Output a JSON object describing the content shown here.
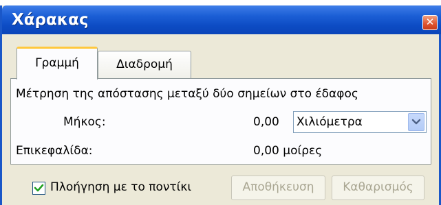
{
  "window": {
    "title": "Χάρακας",
    "close_icon": "close-icon"
  },
  "tabs": [
    {
      "label": "Γραμμή",
      "active": true
    },
    {
      "label": "Διαδρομή",
      "active": false
    }
  ],
  "panel": {
    "description": "Μέτρηση της απόστασης μεταξύ δύο σημείων στο έδαφος",
    "length_label": "Μήκος:",
    "length_value": "0,00",
    "unit_selected": "Χιλιόμετρα",
    "heading_label": "Επικεφαλίδα:",
    "heading_value": "0,00 μοίρες"
  },
  "footer": {
    "mouse_navigation_label": "Πλοήγηση με το ποντίκι",
    "mouse_navigation_checked": true,
    "save_label": "Αποθήκευση",
    "clear_label": "Καθαρισμός"
  },
  "colors": {
    "titlebar": "#0d4cc4",
    "tab_highlight": "#ffc83d",
    "close_button": "#e0532f"
  }
}
